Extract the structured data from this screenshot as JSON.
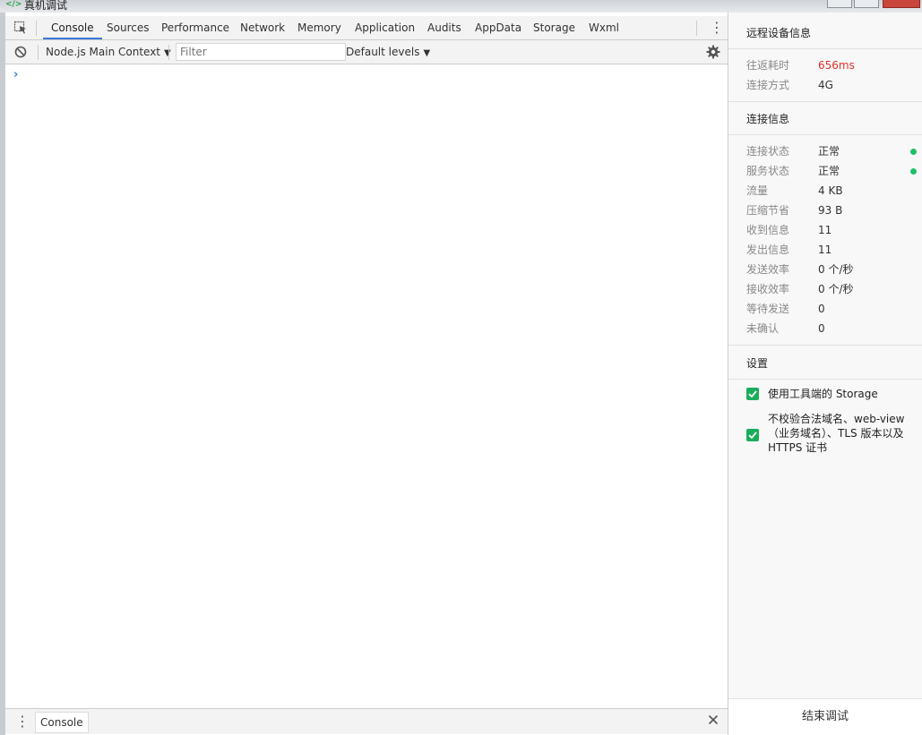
{
  "window": {
    "title": "真机调试",
    "icon_name": "code-icon"
  },
  "tabs": [
    "Console",
    "Sources",
    "Performance",
    "Network",
    "Memory",
    "Application",
    "Audits",
    "AppData",
    "Storage",
    "Wxml"
  ],
  "active_tab": "Console",
  "toolbar": {
    "context_label": "Node.js Main Context",
    "filter_placeholder": "Filter",
    "levels_label": "Default levels"
  },
  "console": {
    "prompt": "›"
  },
  "drawer": {
    "tab_label": "Console"
  },
  "side_panel": {
    "remote_title": "远程设备信息",
    "remote_items": [
      {
        "key": "往返耗时",
        "value": "656ms",
        "highlight": true
      },
      {
        "key": "连接方式",
        "value": "4G"
      }
    ],
    "connection_title": "连接信息",
    "connection_items": [
      {
        "key": "连接状态",
        "value": "正常",
        "status": "ok"
      },
      {
        "key": "服务状态",
        "value": "正常",
        "status": "ok"
      },
      {
        "key": "流量",
        "value": "4 KB"
      },
      {
        "key": "压缩节省",
        "value": "93 B"
      },
      {
        "key": "收到信息",
        "value": "11"
      },
      {
        "key": "发出信息",
        "value": "11"
      },
      {
        "key": "发送效率",
        "value": "0 个/秒"
      },
      {
        "key": "接收效率",
        "value": "0 个/秒"
      },
      {
        "key": "等待发送",
        "value": "0"
      },
      {
        "key": "未确认",
        "value": "0"
      }
    ],
    "settings_title": "设置",
    "settings": [
      {
        "label": "使用工具端的 Storage",
        "checked": true
      },
      {
        "label": "不校验合法域名、web-view（业务域名）、TLS 版本以及 HTTPS 证书",
        "checked": true
      }
    ],
    "end_button": "结束调试"
  },
  "colors": {
    "accent": "#3879d9",
    "ok": "#1fbf6b",
    "check": "#1aad5c",
    "warn": "#e0302a"
  }
}
